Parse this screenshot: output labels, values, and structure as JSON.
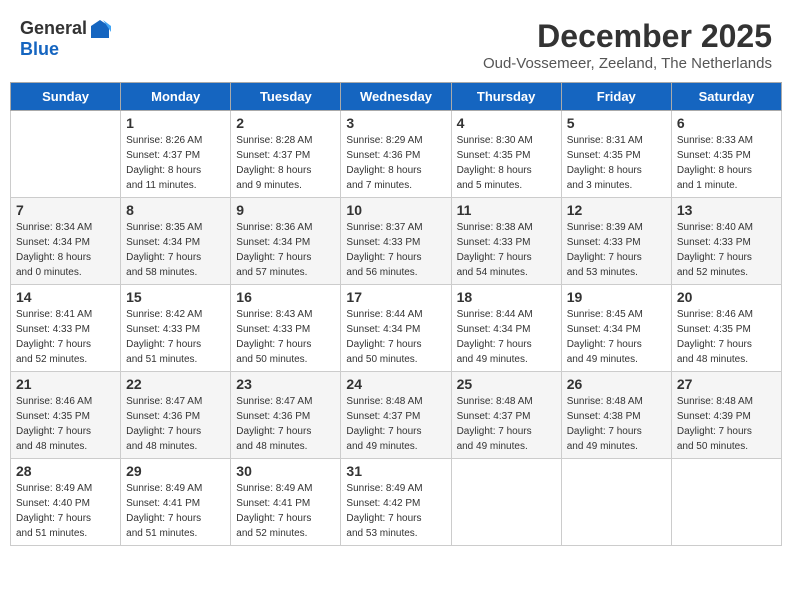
{
  "header": {
    "logo": {
      "general": "General",
      "blue": "Blue"
    },
    "title": "December 2025",
    "subtitle": "Oud-Vossemeer, Zeeland, The Netherlands"
  },
  "calendar": {
    "days_of_week": [
      "Sunday",
      "Monday",
      "Tuesday",
      "Wednesday",
      "Thursday",
      "Friday",
      "Saturday"
    ],
    "weeks": [
      [
        {
          "day": "",
          "info": ""
        },
        {
          "day": "1",
          "info": "Sunrise: 8:26 AM\nSunset: 4:37 PM\nDaylight: 8 hours\nand 11 minutes."
        },
        {
          "day": "2",
          "info": "Sunrise: 8:28 AM\nSunset: 4:37 PM\nDaylight: 8 hours\nand 9 minutes."
        },
        {
          "day": "3",
          "info": "Sunrise: 8:29 AM\nSunset: 4:36 PM\nDaylight: 8 hours\nand 7 minutes."
        },
        {
          "day": "4",
          "info": "Sunrise: 8:30 AM\nSunset: 4:35 PM\nDaylight: 8 hours\nand 5 minutes."
        },
        {
          "day": "5",
          "info": "Sunrise: 8:31 AM\nSunset: 4:35 PM\nDaylight: 8 hours\nand 3 minutes."
        },
        {
          "day": "6",
          "info": "Sunrise: 8:33 AM\nSunset: 4:35 PM\nDaylight: 8 hours\nand 1 minute."
        }
      ],
      [
        {
          "day": "7",
          "info": "Sunrise: 8:34 AM\nSunset: 4:34 PM\nDaylight: 8 hours\nand 0 minutes."
        },
        {
          "day": "8",
          "info": "Sunrise: 8:35 AM\nSunset: 4:34 PM\nDaylight: 7 hours\nand 58 minutes."
        },
        {
          "day": "9",
          "info": "Sunrise: 8:36 AM\nSunset: 4:34 PM\nDaylight: 7 hours\nand 57 minutes."
        },
        {
          "day": "10",
          "info": "Sunrise: 8:37 AM\nSunset: 4:33 PM\nDaylight: 7 hours\nand 56 minutes."
        },
        {
          "day": "11",
          "info": "Sunrise: 8:38 AM\nSunset: 4:33 PM\nDaylight: 7 hours\nand 54 minutes."
        },
        {
          "day": "12",
          "info": "Sunrise: 8:39 AM\nSunset: 4:33 PM\nDaylight: 7 hours\nand 53 minutes."
        },
        {
          "day": "13",
          "info": "Sunrise: 8:40 AM\nSunset: 4:33 PM\nDaylight: 7 hours\nand 52 minutes."
        }
      ],
      [
        {
          "day": "14",
          "info": "Sunrise: 8:41 AM\nSunset: 4:33 PM\nDaylight: 7 hours\nand 52 minutes."
        },
        {
          "day": "15",
          "info": "Sunrise: 8:42 AM\nSunset: 4:33 PM\nDaylight: 7 hours\nand 51 minutes."
        },
        {
          "day": "16",
          "info": "Sunrise: 8:43 AM\nSunset: 4:33 PM\nDaylight: 7 hours\nand 50 minutes."
        },
        {
          "day": "17",
          "info": "Sunrise: 8:44 AM\nSunset: 4:34 PM\nDaylight: 7 hours\nand 50 minutes."
        },
        {
          "day": "18",
          "info": "Sunrise: 8:44 AM\nSunset: 4:34 PM\nDaylight: 7 hours\nand 49 minutes."
        },
        {
          "day": "19",
          "info": "Sunrise: 8:45 AM\nSunset: 4:34 PM\nDaylight: 7 hours\nand 49 minutes."
        },
        {
          "day": "20",
          "info": "Sunrise: 8:46 AM\nSunset: 4:35 PM\nDaylight: 7 hours\nand 48 minutes."
        }
      ],
      [
        {
          "day": "21",
          "info": "Sunrise: 8:46 AM\nSunset: 4:35 PM\nDaylight: 7 hours\nand 48 minutes."
        },
        {
          "day": "22",
          "info": "Sunrise: 8:47 AM\nSunset: 4:36 PM\nDaylight: 7 hours\nand 48 minutes."
        },
        {
          "day": "23",
          "info": "Sunrise: 8:47 AM\nSunset: 4:36 PM\nDaylight: 7 hours\nand 48 minutes."
        },
        {
          "day": "24",
          "info": "Sunrise: 8:48 AM\nSunset: 4:37 PM\nDaylight: 7 hours\nand 49 minutes."
        },
        {
          "day": "25",
          "info": "Sunrise: 8:48 AM\nSunset: 4:37 PM\nDaylight: 7 hours\nand 49 minutes."
        },
        {
          "day": "26",
          "info": "Sunrise: 8:48 AM\nSunset: 4:38 PM\nDaylight: 7 hours\nand 49 minutes."
        },
        {
          "day": "27",
          "info": "Sunrise: 8:48 AM\nSunset: 4:39 PM\nDaylight: 7 hours\nand 50 minutes."
        }
      ],
      [
        {
          "day": "28",
          "info": "Sunrise: 8:49 AM\nSunset: 4:40 PM\nDaylight: 7 hours\nand 51 minutes."
        },
        {
          "day": "29",
          "info": "Sunrise: 8:49 AM\nSunset: 4:41 PM\nDaylight: 7 hours\nand 51 minutes."
        },
        {
          "day": "30",
          "info": "Sunrise: 8:49 AM\nSunset: 4:41 PM\nDaylight: 7 hours\nand 52 minutes."
        },
        {
          "day": "31",
          "info": "Sunrise: 8:49 AM\nSunset: 4:42 PM\nDaylight: 7 hours\nand 53 minutes."
        },
        {
          "day": "",
          "info": ""
        },
        {
          "day": "",
          "info": ""
        },
        {
          "day": "",
          "info": ""
        }
      ]
    ]
  }
}
